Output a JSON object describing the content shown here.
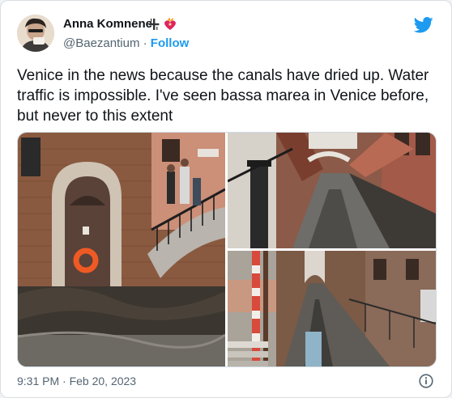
{
  "author": {
    "display_name": "Anna Komnene",
    "handle": "@Baezantium",
    "separator": "·",
    "follow_label": "Follow",
    "badges": [
      "cross-emoji-icon",
      "flaming-heart-emoji-icon"
    ]
  },
  "tweet": {
    "text": "Venice in the news because the canals have dried up. Water traffic is impossible. I've seen bassa marea in Venice before, but never to this extent",
    "timestamp": "9:31 PM · Feb 20, 2023"
  },
  "media": [
    {
      "kind": "photo",
      "subject": "arched doorway with orange life ring beside dry canal bed and bridge with pedestrians"
    },
    {
      "kind": "photo",
      "subject": "long dried canal between brick buildings with small bridge"
    },
    {
      "kind": "photo",
      "subject": "dry canal bed with red-and-white mooring poles"
    }
  ],
  "icons": {
    "brand": "twitter-bird-icon",
    "info": "info-icon"
  },
  "colors": {
    "brand_blue": "#1d9bf0",
    "text": "#0f1419",
    "secondary": "#536471"
  }
}
